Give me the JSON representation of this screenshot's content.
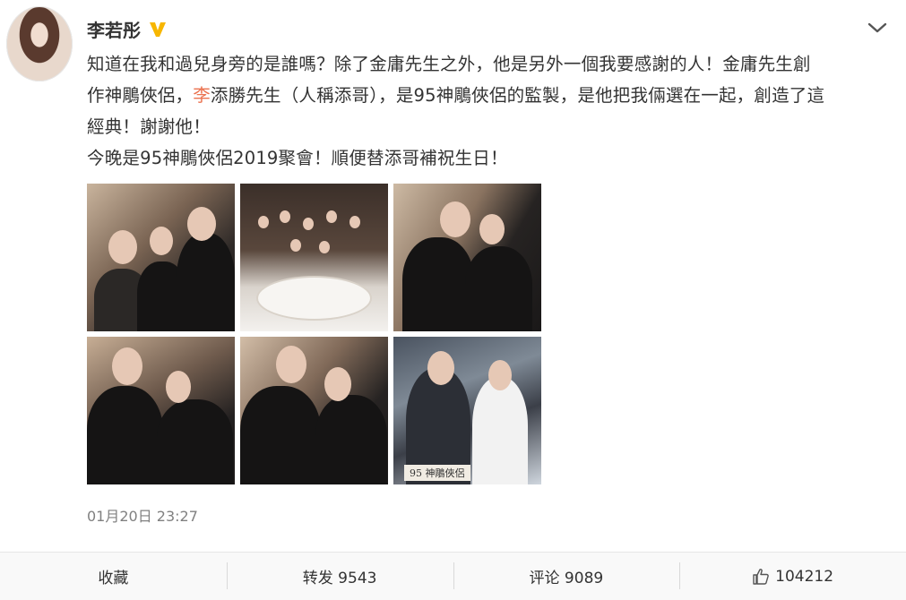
{
  "post": {
    "author": "李若彤",
    "verified_icon": "verified-v-icon",
    "menu_icon": "chevron-down-icon",
    "text_line1": "知道在我和過兒身旁的是誰嗎？除了金庸先生之外，他是另外一個我要感謝的人！金庸先生創",
    "text_line2_pre": "作神鵰俠侶，",
    "text_line2_hl": "李",
    "text_line2_post": "添勝先生（人稱添哥），是95神鵰俠侶的監製，是他把我倆選在一起，創造了這",
    "text_line3": "經典！謝謝他！",
    "text_line4": "今晚是95神鵰俠侶2019聚會！順便替添哥補祝生日！",
    "photo6_caption": "95 神鵰俠侶",
    "date": "01月20日 23:27",
    "highlight_color": "#eb7350"
  },
  "actions": {
    "favorite": "收藏",
    "repost": "转发 9543",
    "comment": "评论 9089",
    "like_icon": "thumbs-up-icon",
    "like_count": "104212"
  }
}
